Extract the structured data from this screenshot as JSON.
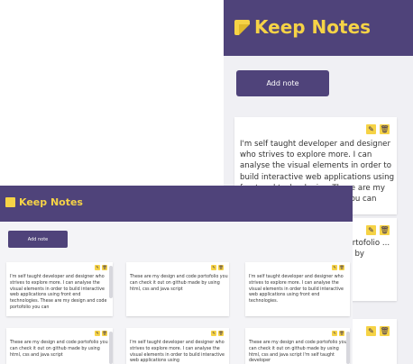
{
  "app": {
    "title": "Keep Notes"
  },
  "actions": {
    "add_note": "Add note"
  },
  "icons": {
    "edit": "edit-icon",
    "delete": "trash-icon",
    "logo": "note-logo-icon"
  },
  "colors": {
    "header": "#4f437a",
    "accent": "#f6d346"
  },
  "notes": [
    {
      "text": "I'm self taught developer and designer who strives to explore more. I can analyse the visual elements in order to build interactive web applications using front end technologies. These are my design and code portofolio you can"
    },
    {
      "text": "These are my design and code portofolio you can check it out on github made by using html, css and java script"
    },
    {
      "text": "I'm self taught developer and designer who strives to explore more. I can analyse the visual elements in order to build interactive web applications using front end technologies."
    },
    {
      "text": "These are my design and code portofolio you can check it out on github made by using html, css and java script"
    },
    {
      "text": "I'm self taught developer and designer who strives to explore more. I can analyse the visual elements in order to build interactive web applications using"
    },
    {
      "text": "These are my design and code portofolio you can check it out on github made by using html, css and java script I'm self taught developer"
    }
  ],
  "zoomed_notes": [
    {
      "text": "I'm self taught developer and designer who strives to explore more. I can analyse the visual elements in order to build interactive web applications using front end technologies. These are my design and code portofolio you can check it out"
    },
    {
      "text": "portofolio ... de by"
    }
  ]
}
